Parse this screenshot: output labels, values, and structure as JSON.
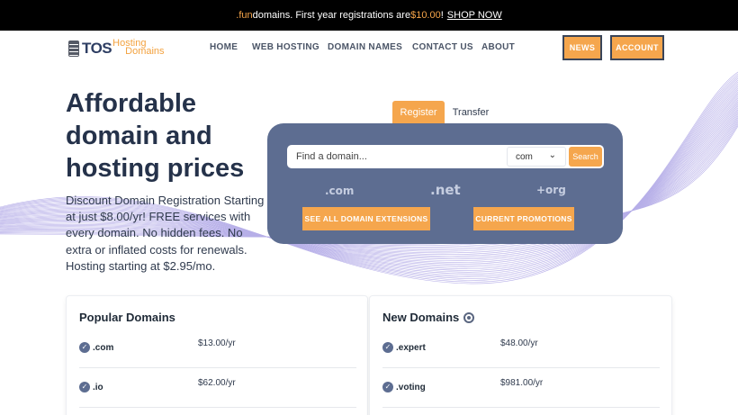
{
  "announcement": {
    "highlight": ".fun",
    "text_middle": " domains. First year registrations are ",
    "price": "$10.00",
    "text_end": "!",
    "link": "SHOP NOW"
  },
  "logo": {
    "tos": "TOS",
    "hosting": "Hosting",
    "domains": "Domains"
  },
  "nav": {
    "home": "HOME",
    "web_hosting": "WEB HOSTING",
    "domain_names": "DOMAIN NAMES",
    "contact_us": "CONTACT US",
    "about": "ABOUT"
  },
  "header_buttons": {
    "news": "NEWS",
    "account": "ACCOUNT"
  },
  "hero": {
    "title": "Affordable domain and hosting prices",
    "description": "Discount Domain Registration Starting at just $8.00/yr! FREE services with every domain. No hidden fees. No extra or inflated costs for renewals. Hosting starting at $2.95/mo."
  },
  "search": {
    "tabs": {
      "register": "Register",
      "transfer": "Transfer"
    },
    "placeholder": "Find a domain...",
    "selected_tld": "com",
    "button": "Search",
    "extensions": [
      ".com",
      ".net",
      "+org"
    ],
    "see_all": "SEE ALL DOMAIN EXTENSIONS",
    "promotions": "CURRENT PROMOTIONS"
  },
  "popular_domains": {
    "title": "Popular Domains",
    "rows": [
      {
        "tld": ".com",
        "price": "$13.00/yr"
      },
      {
        "tld": ".io",
        "price": "$62.00/yr"
      }
    ]
  },
  "new_domains": {
    "title": "New Domains",
    "rows": [
      {
        "tld": ".expert",
        "price": "$48.00/yr"
      },
      {
        "tld": ".voting",
        "price": "$981.00/yr"
      }
    ]
  },
  "colors": {
    "accent": "#f5a64d",
    "panel": "#5d6d91",
    "heading": "#25324a",
    "announce_bg": "#000000"
  }
}
